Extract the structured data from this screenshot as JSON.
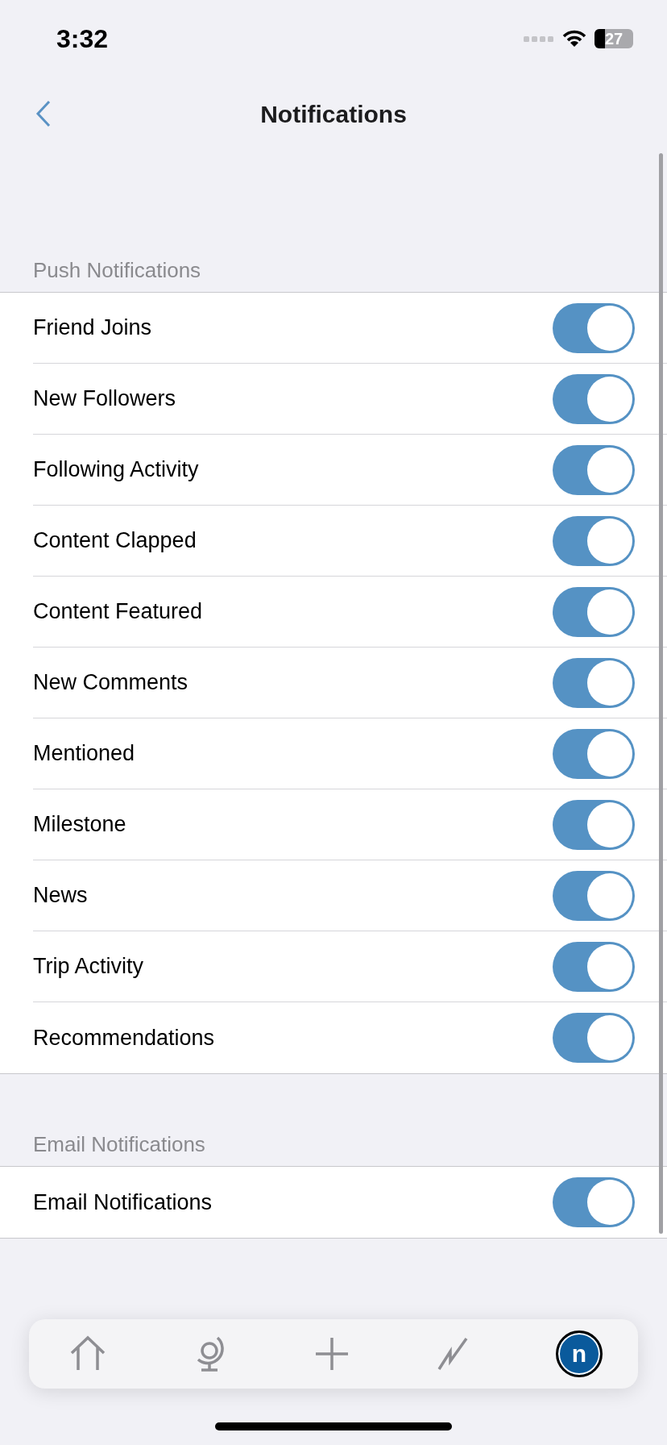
{
  "status_bar": {
    "time": "3:32",
    "battery": "27"
  },
  "nav": {
    "title": "Notifications"
  },
  "sections": [
    {
      "header": "Push Notifications",
      "items": [
        {
          "label": "Friend Joins",
          "on": true
        },
        {
          "label": "New Followers",
          "on": true
        },
        {
          "label": "Following Activity",
          "on": true
        },
        {
          "label": "Content Clapped",
          "on": true
        },
        {
          "label": "Content Featured",
          "on": true
        },
        {
          "label": "New Comments",
          "on": true
        },
        {
          "label": "Mentioned",
          "on": true
        },
        {
          "label": "Milestone",
          "on": true
        },
        {
          "label": "News",
          "on": true
        },
        {
          "label": "Trip Activity",
          "on": true
        },
        {
          "label": "Recommendations",
          "on": true
        }
      ]
    },
    {
      "header": "Email Notifications",
      "items": [
        {
          "label": "Email Notifications",
          "on": true
        }
      ]
    }
  ],
  "tab_bar": {
    "items": [
      {
        "kind": "home"
      },
      {
        "kind": "explore"
      },
      {
        "kind": "add"
      },
      {
        "kind": "activity"
      },
      {
        "kind": "avatar",
        "initial": "n"
      }
    ]
  }
}
